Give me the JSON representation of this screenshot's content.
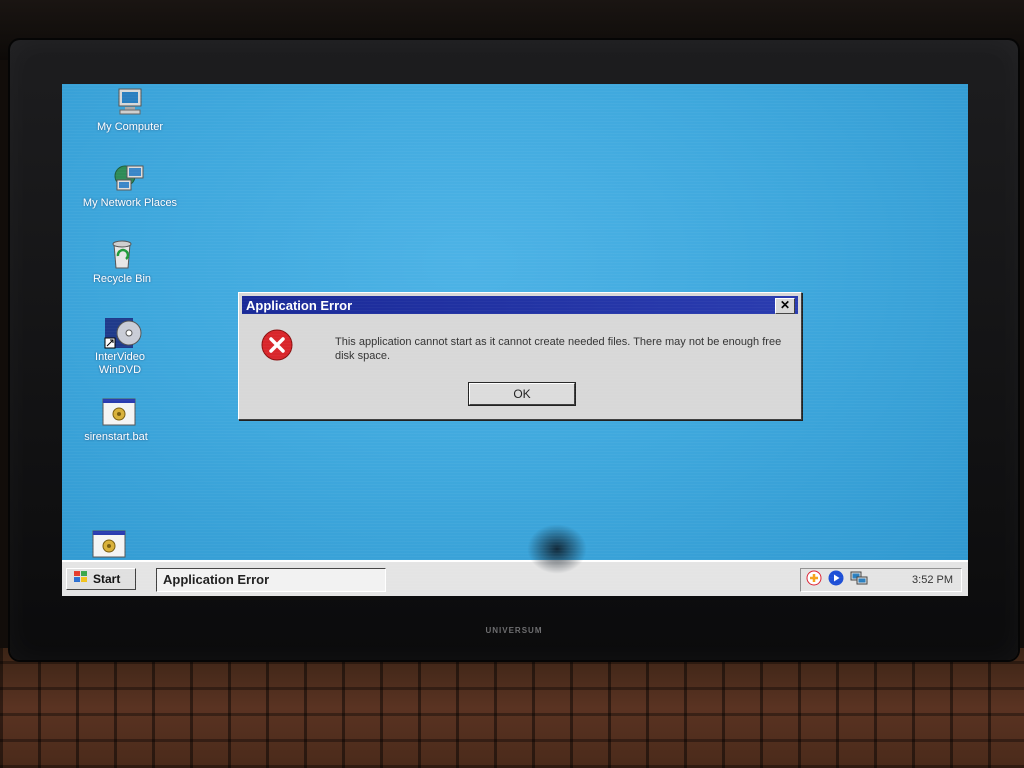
{
  "desktop": {
    "icons": [
      {
        "label": "My Computer",
        "icon": "my-computer-icon"
      },
      {
        "label": "My Network Places",
        "icon": "network-places-icon"
      },
      {
        "label": "Recycle Bin",
        "icon": "recycle-bin-icon"
      },
      {
        "label": "InterVideo WinDVD",
        "icon": "windvd-icon"
      },
      {
        "label": "sirenstart.bat",
        "icon": "batch-file-icon"
      },
      {
        "label": "",
        "icon": "batch-file-icon"
      }
    ]
  },
  "dialog": {
    "title": "Application Error",
    "close_label": "✕",
    "message": "This application cannot start as it cannot create needed files. There may not be enough free disk space.",
    "ok_label": "OK",
    "icon": "error-icon"
  },
  "taskbar": {
    "start_label": "Start",
    "task_label": "Application Error",
    "clock": "3:52 PM",
    "tray_icons": [
      "realplayer-icon",
      "media-icon",
      "network-tray-icon"
    ]
  },
  "monitor": {
    "brand": "UNIVERSUM"
  },
  "colors": {
    "desktop": "#3fa8dd",
    "titlebar": "#1a2a98",
    "error_red": "#d9262b"
  }
}
